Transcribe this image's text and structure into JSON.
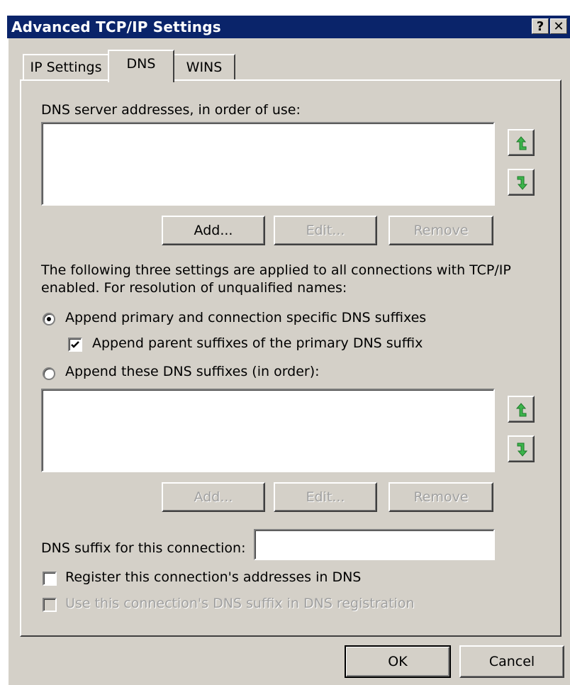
{
  "window": {
    "title": "Advanced TCP/IP Settings",
    "help_button": "?",
    "close_button": "✕"
  },
  "tabs": [
    {
      "label": "IP Settings",
      "selected": false
    },
    {
      "label": "DNS",
      "selected": true
    },
    {
      "label": "WINS",
      "selected": false
    }
  ],
  "dns_servers": {
    "label": "DNS server addresses, in order of use:",
    "items": [],
    "add_label": "Add...",
    "edit_label": "Edit...",
    "remove_label": "Remove"
  },
  "resolution": {
    "description_line1": "The following three settings are applied to all connections with TCP/IP",
    "description_line2": "enabled. For resolution of unqualified names:",
    "option_primary_label": "Append primary and connection specific DNS suffixes",
    "option_primary_selected": true,
    "parent_suffixes_label": "Append parent suffixes of the primary DNS suffix",
    "parent_suffixes_checked": true,
    "option_these_label": "Append these DNS suffixes (in order):",
    "option_these_selected": false
  },
  "dns_suffixes": {
    "items": [],
    "add_label": "Add...",
    "edit_label": "Edit...",
    "remove_label": "Remove"
  },
  "connection_suffix": {
    "label": "DNS suffix for this connection:",
    "value": ""
  },
  "registration": {
    "register_label": "Register this connection's addresses in DNS",
    "register_checked": false,
    "use_suffix_label": "Use this connection's DNS suffix in DNS registration",
    "use_suffix_checked": false
  },
  "footer": {
    "ok_label": "OK",
    "cancel_label": "Cancel"
  },
  "colors": {
    "titlebar": "#0a246a",
    "face": "#d4d0c8",
    "arrow_green": "#3cb44b"
  },
  "icons": {
    "move_up": "green-up-arrow-icon",
    "move_down": "green-down-arrow-icon"
  }
}
